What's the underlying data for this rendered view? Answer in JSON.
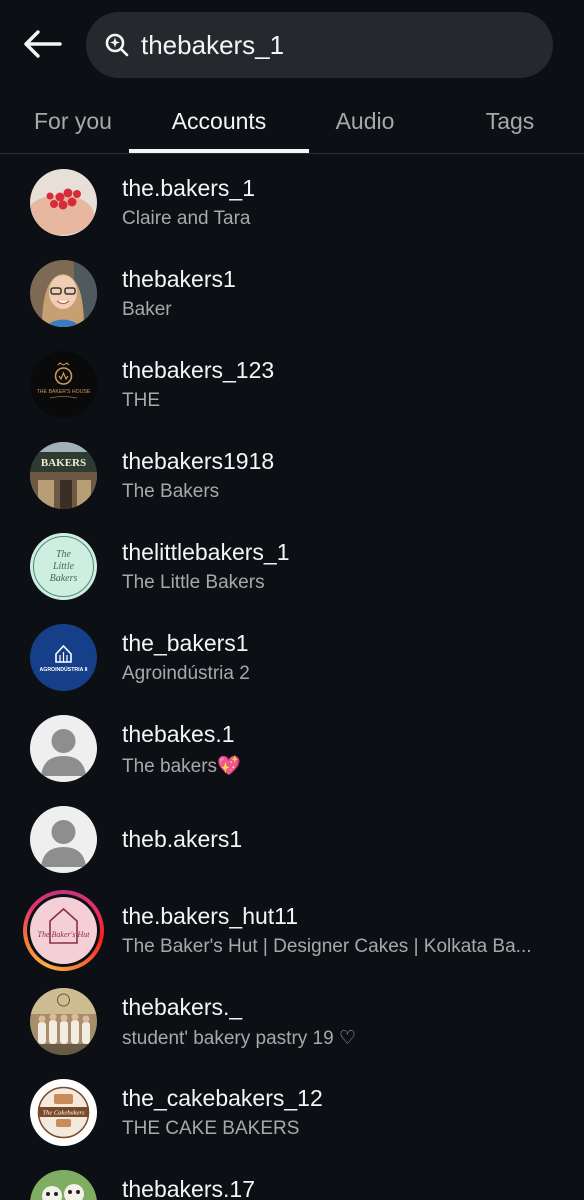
{
  "header": {
    "back_icon": "arrow-left-icon",
    "search_icon": "search-icon",
    "search_value": "thebakers_1"
  },
  "tabs": [
    {
      "label": "For you",
      "active": false
    },
    {
      "label": "Accounts",
      "active": true
    },
    {
      "label": "Audio",
      "active": false
    },
    {
      "label": "Tags",
      "active": false
    }
  ],
  "accounts": [
    {
      "username": "the.bakers_1",
      "full_name": "Claire and Tara",
      "avatar": "raspberries-photo"
    },
    {
      "username": "thebakers1",
      "full_name": "Baker",
      "avatar": "girl-portrait-photo"
    },
    {
      "username": "thebakers_123",
      "full_name": "THE",
      "avatar": "bakers-house-logo",
      "avatar_text": "THE BAKER'S HOUSE"
    },
    {
      "username": "thebakers1918",
      "full_name": "The Bakers",
      "avatar": "storefront-photo",
      "avatar_text": "BAKERS"
    },
    {
      "username": "thelittlebakers_1",
      "full_name": "The Little Bakers",
      "avatar": "little-bakers-logo",
      "avatar_text": "The Little Bakers"
    },
    {
      "username": "the_bakers1",
      "full_name": "Agroindústria 2",
      "avatar": "agroindustria-logo",
      "avatar_text": "AGROINDÚSTRIA II"
    },
    {
      "username": "thebakes.1",
      "full_name": "The bakers💖",
      "avatar": "default-avatar"
    },
    {
      "username": "theb.akers1",
      "full_name": "",
      "avatar": "default-avatar"
    },
    {
      "username": "the.bakers_hut11",
      "full_name": "The Baker's Hut | Designer Cakes | Kolkata Ba...",
      "avatar": "bakers-hut-logo",
      "avatar_text": "The Baker's Hut",
      "story_ring": true
    },
    {
      "username": "thebakers._",
      "full_name": "student' bakery pastry 19 ♡",
      "avatar": "group-photo"
    },
    {
      "username": "the_cakebakers_12",
      "full_name": "THE CAKE BAKERS",
      "avatar": "cake-bakers-logo",
      "avatar_text": "The Cakebakers"
    },
    {
      "username": "thebakers.17",
      "full_name": "",
      "avatar": "dogs-photo"
    }
  ],
  "colors": {
    "background": "#0c1014",
    "search_bg": "#25292e",
    "text_primary": "#f5f5f5",
    "text_secondary": "#a8a8a8",
    "divider": "#2a2e33"
  }
}
